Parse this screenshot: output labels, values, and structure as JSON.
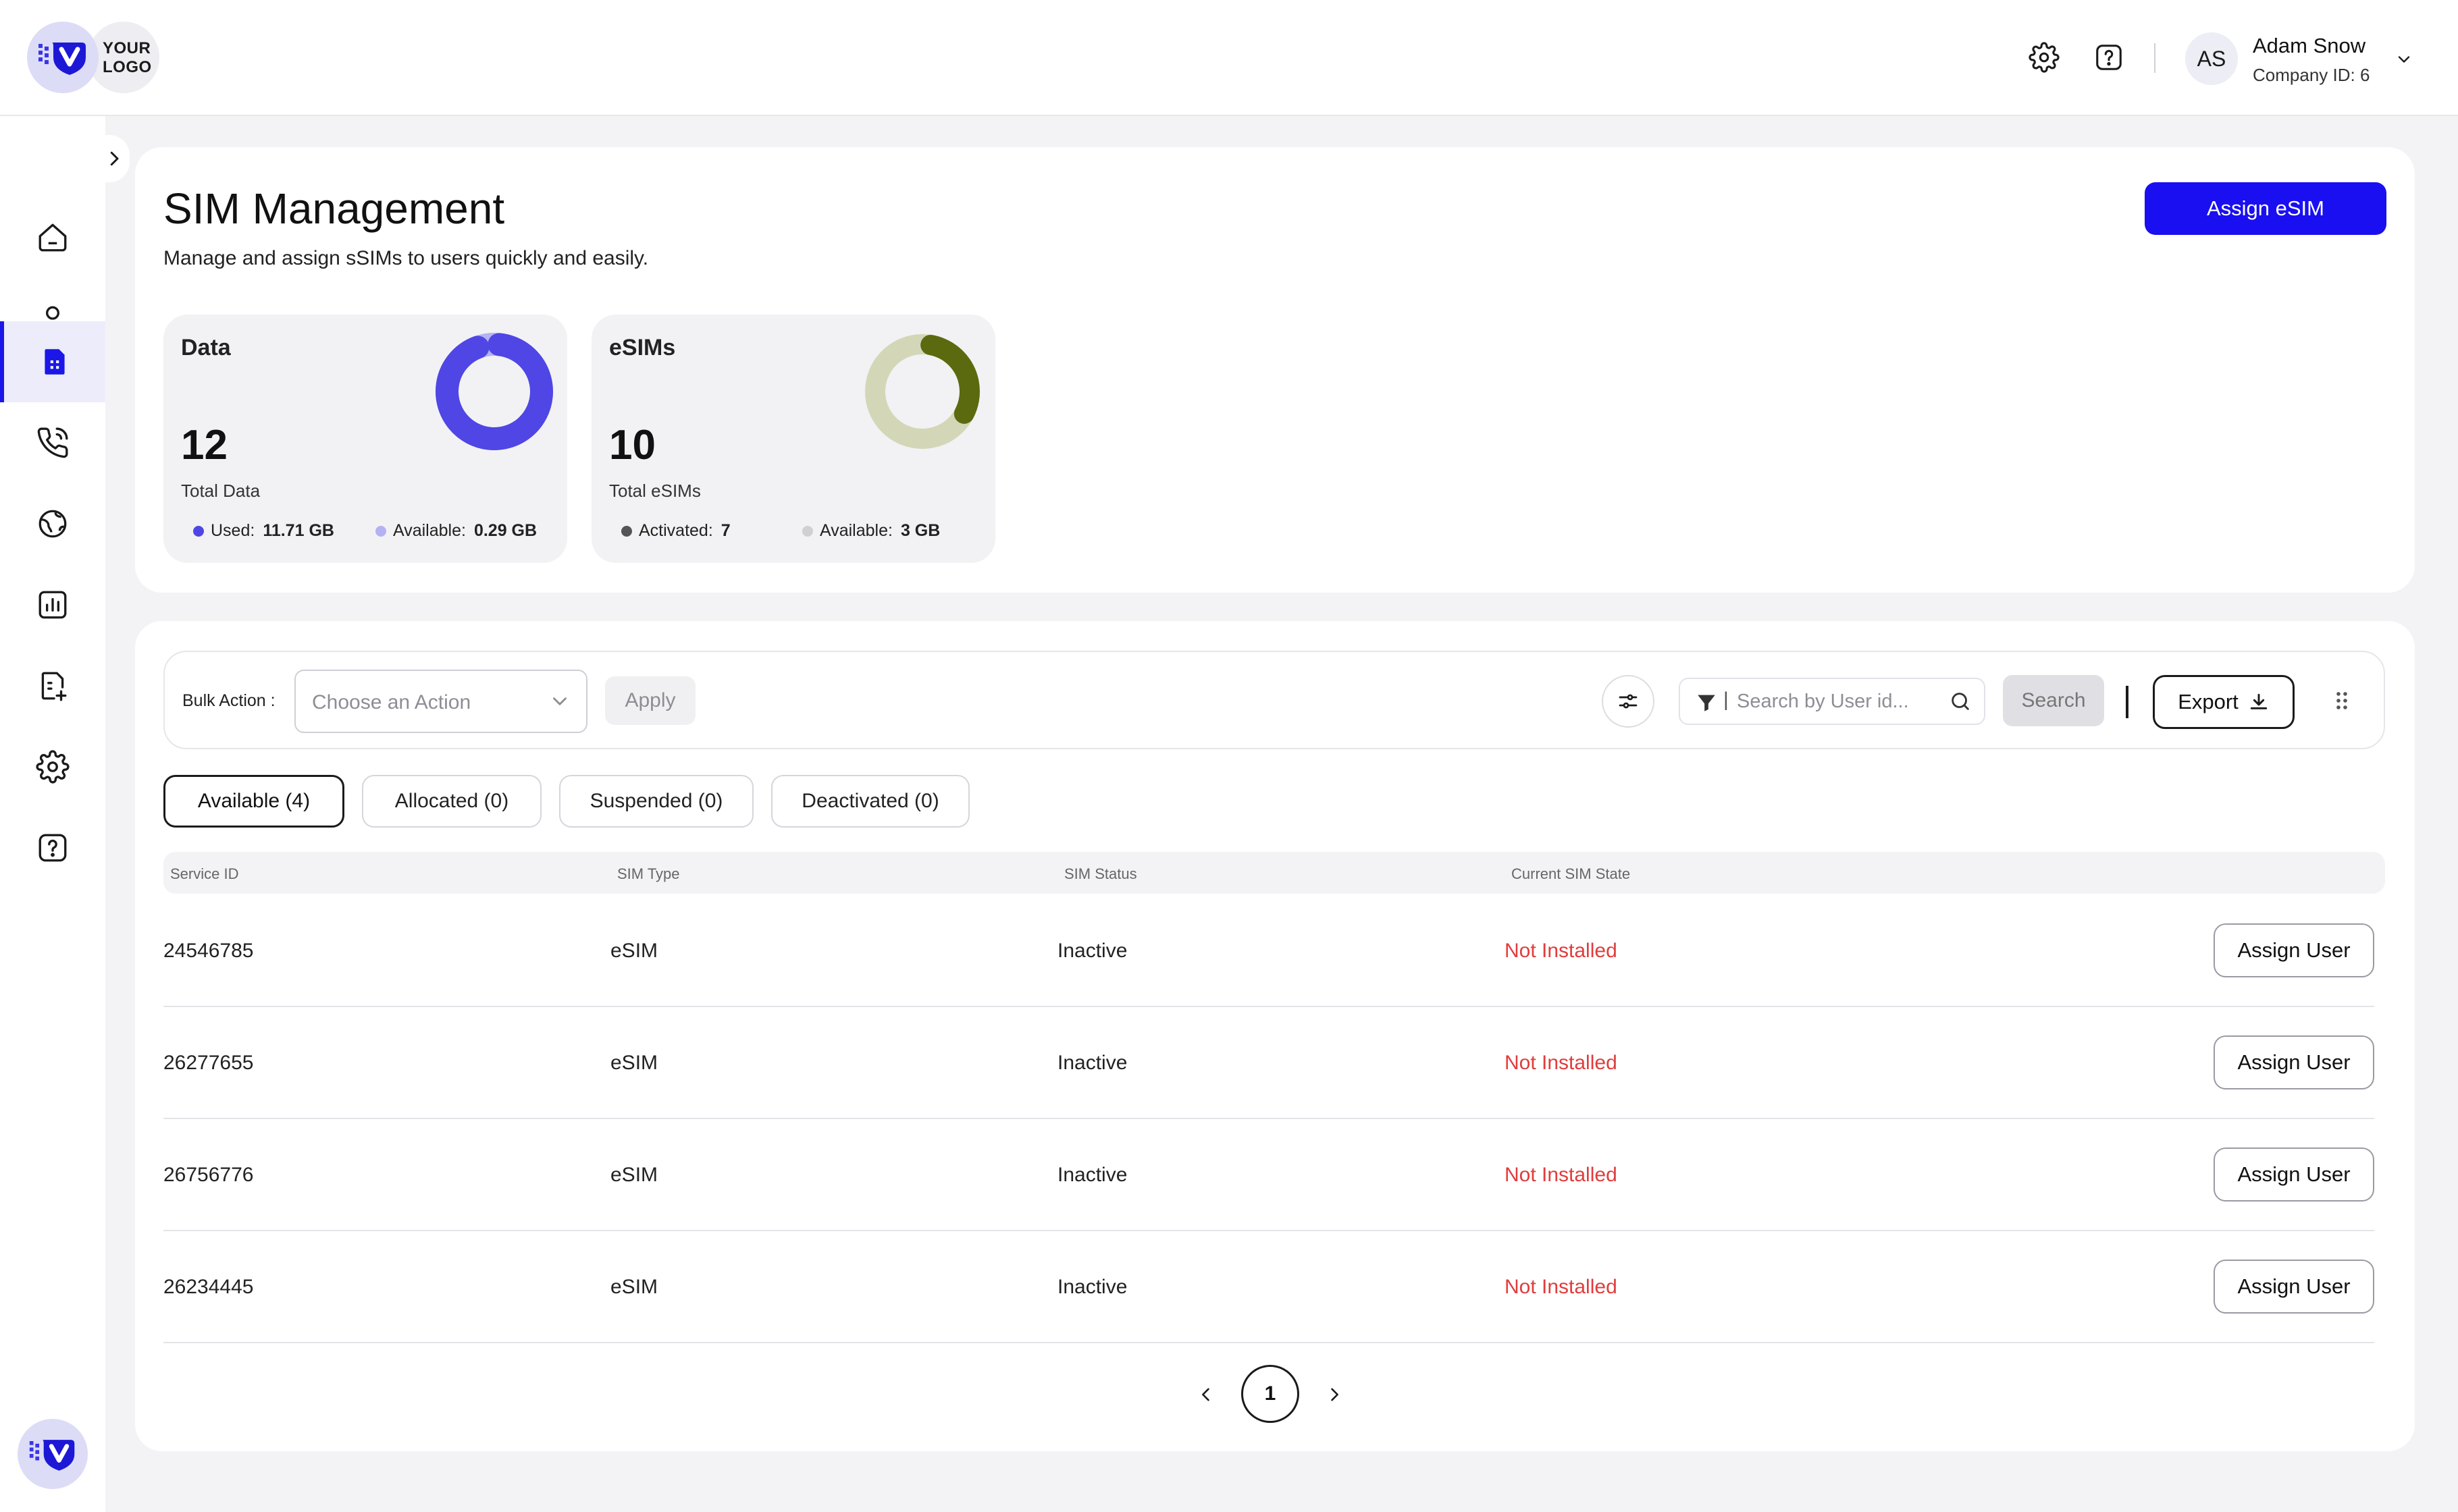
{
  "header": {
    "logo_text_line1": "YOUR",
    "logo_text_line2": "LOGO",
    "settings_icon": "gear-icon",
    "help_icon": "help-icon",
    "user": {
      "initials": "AS",
      "name": "Adam Snow",
      "company": "Company ID: 6"
    }
  },
  "sidebar": {
    "items": [
      {
        "icon": "home-icon"
      },
      {
        "icon": "user-icon"
      },
      {
        "icon": "sim-card-icon",
        "active": true
      },
      {
        "icon": "phone-call-icon"
      },
      {
        "icon": "globe-icon"
      },
      {
        "icon": "bar-chart-icon"
      },
      {
        "icon": "add-document-icon"
      },
      {
        "icon": "gear-icon"
      },
      {
        "icon": "help-icon"
      }
    ]
  },
  "page": {
    "title": "SIM Management",
    "subtitle": "Manage and assign sSIMs to users quickly and easily.",
    "assign_button": "Assign eSIM"
  },
  "stats": {
    "data": {
      "title": "Data",
      "total": "12",
      "total_label": "Total Data",
      "used_label": "Used:",
      "used_value": "11.71 GB",
      "available_label": "Available:",
      "available_value": "0.29 GB",
      "used_fraction": 0.976,
      "colors": {
        "used": "#4f46e5",
        "available": "#b4b2f2"
      }
    },
    "esims": {
      "title": "eSIMs",
      "total": "10",
      "total_label": "Total eSIMs",
      "activated_label": "Activated:",
      "activated_value": "7",
      "available_label": "Available:",
      "available_value": "3 GB",
      "activated_fraction": 0.3,
      "colors": {
        "activated": "#5b6a0f",
        "available": "#d3d7b8"
      }
    }
  },
  "toolbar": {
    "bulk_label": "Bulk Action :",
    "select_placeholder": "Choose an Action",
    "apply_label": "Apply",
    "search_placeholder": "Search by User id...",
    "search_label": "Search",
    "export_label": "Export"
  },
  "tabs": [
    {
      "label": "Available (4)",
      "active": true
    },
    {
      "label": "Allocated (0)"
    },
    {
      "label": "Suspended (0)"
    },
    {
      "label": "Deactivated (0)"
    }
  ],
  "table": {
    "columns": [
      "Service ID",
      "SIM Type",
      "SIM Status",
      "Current SIM State"
    ],
    "rows": [
      {
        "service_id": "24546785",
        "sim_type": "eSIM",
        "sim_status": "Inactive",
        "sim_state": "Not Installed",
        "action": "Assign User"
      },
      {
        "service_id": "26277655",
        "sim_type": "eSIM",
        "sim_status": "Inactive",
        "sim_state": "Not Installed",
        "action": "Assign User"
      },
      {
        "service_id": "26756776",
        "sim_type": "eSIM",
        "sim_status": "Inactive",
        "sim_state": "Not Installed",
        "action": "Assign User"
      },
      {
        "service_id": "26234445",
        "sim_type": "eSIM",
        "sim_status": "Inactive",
        "sim_state": "Not Installed",
        "action": "Assign User"
      }
    ]
  },
  "pagination": {
    "current_page": "1"
  },
  "colors": {
    "primary": "#1a0ff0",
    "danger": "#e13c3c",
    "sidebar_active": "#1b17e8"
  }
}
